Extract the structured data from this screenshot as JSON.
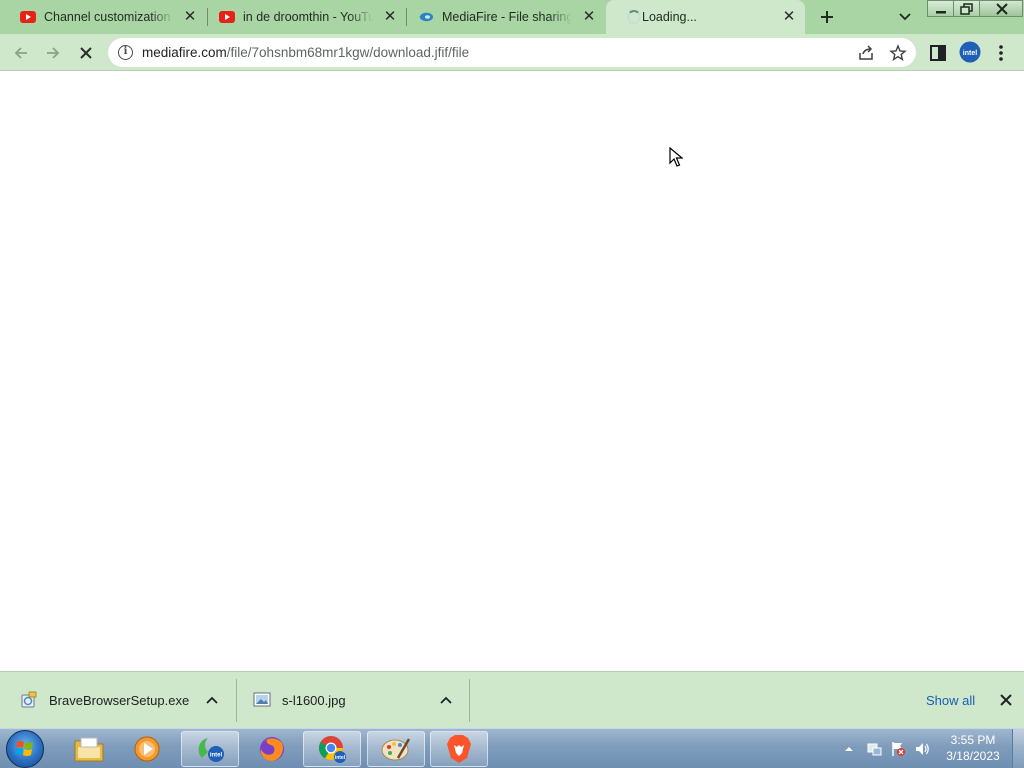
{
  "browser": {
    "tabs": [
      {
        "title": "Channel customization -",
        "icon": "youtube-icon",
        "active": false
      },
      {
        "title": "in de droomthin - YouTube",
        "icon": "youtube-icon",
        "active": false
      },
      {
        "title": "MediaFire - File sharing a",
        "icon": "mediafire-icon",
        "active": false
      },
      {
        "title": "Loading...",
        "icon": "loading-spinner-icon",
        "active": true
      }
    ],
    "new_tab_icon": "plus-icon",
    "address": {
      "host": "mediafire.com",
      "path": "/file/7ohsnbm68mr1kgw/download.jfif/file"
    },
    "profile_badge": "intel"
  },
  "downloads": {
    "items": [
      {
        "name": "BraveBrowserSetup.exe",
        "icon": "installer-icon"
      },
      {
        "name": "s-l1600.jpg",
        "icon": "image-file-icon"
      }
    ],
    "show_all_label": "Show all"
  },
  "taskbar": {
    "apps": [
      "windows-explorer",
      "windows-media-player",
      "intel-app",
      "firefox",
      "chrome",
      "paint",
      "brave"
    ],
    "clock": {
      "time": "3:55 PM",
      "date": "3/18/2023"
    }
  },
  "colors": {
    "tab_strip": "#a9d4a4",
    "toolbar": "#cfe7cb",
    "link": "#1a5fb4",
    "taskbar": "#7f9cbb"
  }
}
